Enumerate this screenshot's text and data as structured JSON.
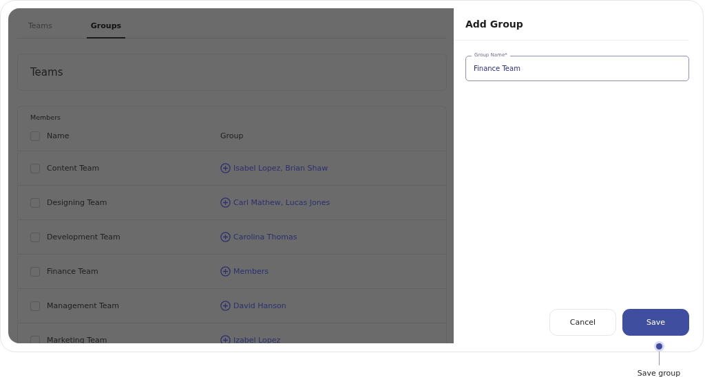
{
  "tabs": [
    {
      "label": "Teams",
      "selected": false
    },
    {
      "label": "Groups",
      "selected": true
    }
  ],
  "heading": "Teams",
  "members": {
    "label": "Members",
    "select_all": {
      "checked": false
    },
    "columns": [
      "Name",
      "Group"
    ],
    "rows": [
      {
        "name": "Content Team",
        "group": "Isabel Lopez, Brian Shaw",
        "checked": false
      },
      {
        "name": "Designing Team",
        "group": "Carl Mathew, Lucas Jones",
        "checked": false
      },
      {
        "name": "Development Team",
        "group": "Carolina Thomas",
        "checked": false
      },
      {
        "name": "Finance Team",
        "group": "Members",
        "checked": false
      },
      {
        "name": "Management Team",
        "group": "David Hanson",
        "checked": false
      },
      {
        "name": "Marketing Team",
        "group": "Izabel Lopez",
        "checked": false
      }
    ]
  },
  "panel": {
    "title": "Add Group",
    "field": {
      "label": "Group Name*",
      "value": "Finance Team"
    },
    "buttons": [
      {
        "label": "Cancel",
        "kind": "secondary"
      },
      {
        "label": "Save",
        "kind": "primary"
      }
    ]
  },
  "annotation": {
    "text": "Save group"
  }
}
